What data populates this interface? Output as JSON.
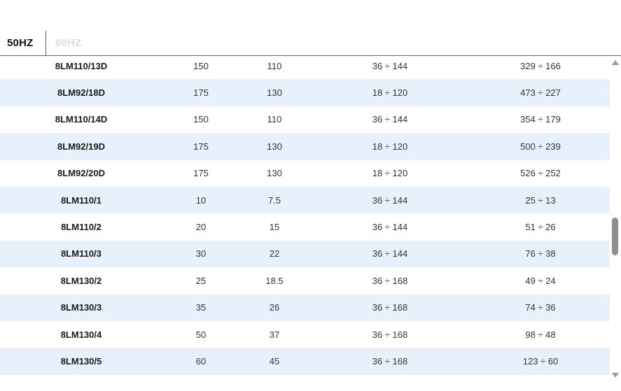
{
  "tabs": [
    {
      "label": "50HZ",
      "active": true
    },
    {
      "label": "60HZ",
      "active": false
    }
  ],
  "rows": [
    [
      "8LM110/13D",
      "150",
      "110",
      "36 ÷ 144",
      "329 ÷ 166"
    ],
    [
      "8LM92/18D",
      "175",
      "130",
      "18 ÷ 120",
      "473 ÷ 227"
    ],
    [
      "8LM110/14D",
      "150",
      "110",
      "36 ÷ 144",
      "354 ÷ 179"
    ],
    [
      "8LM92/19D",
      "175",
      "130",
      "18 ÷ 120",
      "500 ÷ 239"
    ],
    [
      "8LM92/20D",
      "175",
      "130",
      "18 ÷ 120",
      "526 ÷ 252"
    ],
    [
      "8LM110/1",
      "10",
      "7.5",
      "36 ÷ 144",
      "25 ÷ 13"
    ],
    [
      "8LM110/2",
      "20",
      "15",
      "36 ÷ 144",
      "51 ÷ 26"
    ],
    [
      "8LM110/3",
      "30",
      "22",
      "36 ÷ 144",
      "76 ÷ 38"
    ],
    [
      "8LM130/2",
      "25",
      "18.5",
      "36 ÷ 168",
      "49 ÷ 24"
    ],
    [
      "8LM130/3",
      "35",
      "26",
      "36 ÷ 168",
      "74 ÷ 36"
    ],
    [
      "8LM130/4",
      "50",
      "37",
      "36 ÷ 168",
      "98 ÷ 48"
    ],
    [
      "8LM130/5",
      "60",
      "45",
      "36 ÷ 168",
      "123 ÷ 60"
    ]
  ],
  "colors": {
    "accent": "#2a6db5",
    "row_alt": "#e6f1fc",
    "inactive_tab": "#d8dde3"
  },
  "icons": {
    "scroll_up": "chevron-up-icon",
    "scroll_down": "chevron-down-icon"
  }
}
